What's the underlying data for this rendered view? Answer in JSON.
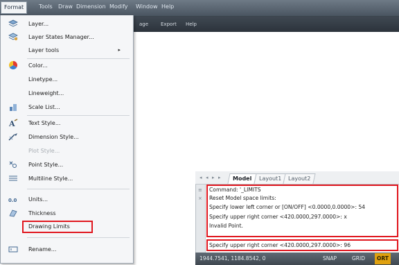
{
  "menubar": {
    "items": [
      "Format",
      "Tools",
      "Draw",
      "Dimension",
      "Modify",
      "Window",
      "Help"
    ]
  },
  "ribbon": {
    "tabs": [
      "age",
      "Export",
      "Help"
    ]
  },
  "format_menu": {
    "items": [
      {
        "label": "Layer...",
        "icon": "layers-icon"
      },
      {
        "label": "Layer States Manager...",
        "icon": "layer-states-icon"
      },
      {
        "label": "Layer tools",
        "icon": "",
        "submenu_arrow": "▸"
      },
      {
        "label": "Color...",
        "icon": "color-wheel-icon"
      },
      {
        "label": "Linetype...",
        "icon": ""
      },
      {
        "label": "Lineweight...",
        "icon": ""
      },
      {
        "label": "Scale List...",
        "icon": "scale-list-icon"
      },
      {
        "label": "Text Style...",
        "icon": "text-style-icon"
      },
      {
        "label": "Dimension Style...",
        "icon": "dimension-style-icon"
      },
      {
        "label": "Plot Style...",
        "icon": "",
        "disabled": true
      },
      {
        "label": "Point Style...",
        "icon": "point-style-icon"
      },
      {
        "label": "Multiline Style...",
        "icon": "multiline-style-icon"
      },
      {
        "label": "Units...",
        "icon": "units-icon"
      },
      {
        "label": "Thickness",
        "icon": "thickness-icon"
      },
      {
        "label": "Drawing Limits",
        "icon": "",
        "highlighted": true
      },
      {
        "label": "Rename...",
        "icon": "rename-icon"
      }
    ]
  },
  "layout_tabs": {
    "nav": [
      "◂",
      "◂",
      "▸",
      "▸"
    ],
    "tabs": [
      "Model",
      "Layout1",
      "Layout2"
    ],
    "active": "Model"
  },
  "command_window": {
    "lines": [
      "Command: '_LIMITS",
      "Reset Model space limits:",
      "Specify lower left corner or [ON/OFF] <0.0000,0.0000>: 54",
      "Specify upper right corner <420.0000,297.0000>: x",
      "Invalid Point.",
      "Specify upper right corner <420.0000,297.0000>: 96"
    ],
    "gutter_glyphs": [
      "≡",
      "×"
    ]
  },
  "status_bar": {
    "coordinates": "1944.7541, 1184.8542, 0",
    "toggles": [
      "SNAP",
      "GRID",
      "ORT"
    ],
    "active_toggle": "ORT"
  },
  "colors": {
    "highlight_box": "#e0161e",
    "ortho_active": "#e0a10f",
    "menubar": "#4a5561"
  }
}
